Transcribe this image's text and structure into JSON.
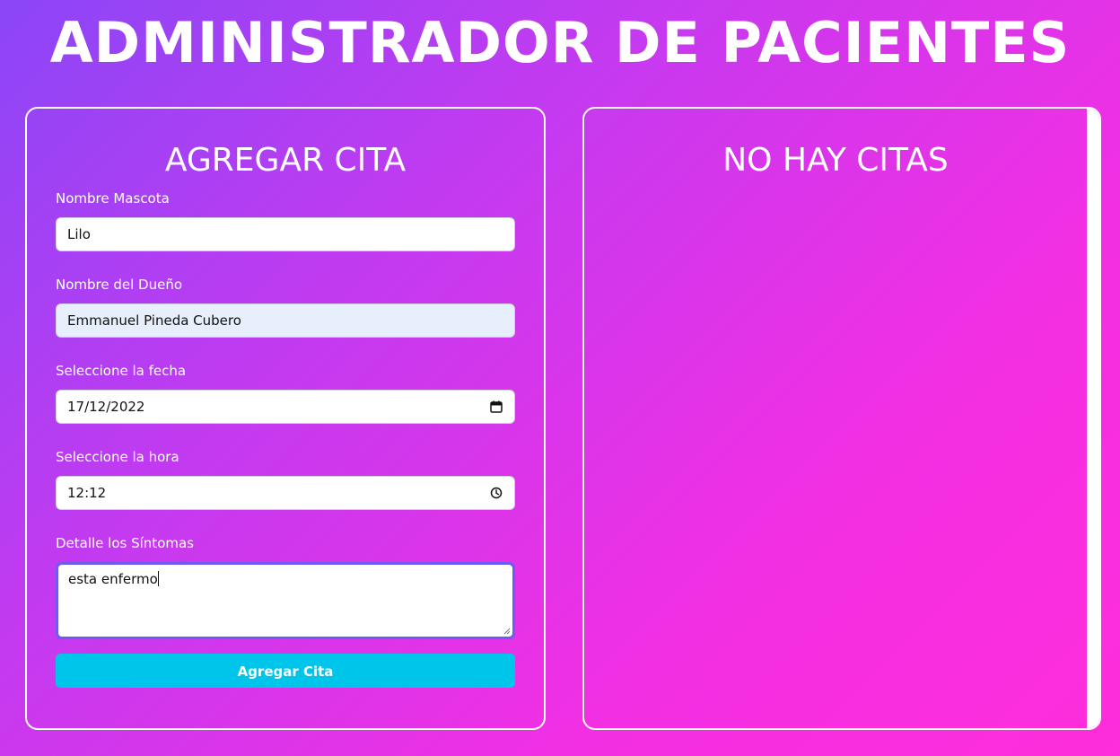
{
  "header": {
    "title": "ADMINISTRADOR DE PACIENTES"
  },
  "form_panel": {
    "heading": "AGREGAR CITA",
    "fields": {
      "pet_name": {
        "label": "Nombre Mascota",
        "value": "Lilo"
      },
      "owner_name": {
        "label": "Nombre del Dueño",
        "value": "Emmanuel Pineda Cubero"
      },
      "date": {
        "label": "Seleccione la fecha",
        "value": "17/12/2022",
        "icon": "calendar-icon"
      },
      "time": {
        "label": "Seleccione la hora",
        "value": "12:12",
        "icon": "clock-icon"
      },
      "symptoms": {
        "label": "Detalle los Síntomas",
        "value": "esta enfermo"
      }
    },
    "submit_label": "Agregar Cita"
  },
  "appointments_panel": {
    "heading": "NO HAY CITAS"
  },
  "colors": {
    "gradient_start": "#8b46f7",
    "gradient_end": "#ff2ddb",
    "button": "#00c5ea",
    "focus_border": "#6d5cf0",
    "autofill_background": "#e6effb"
  }
}
